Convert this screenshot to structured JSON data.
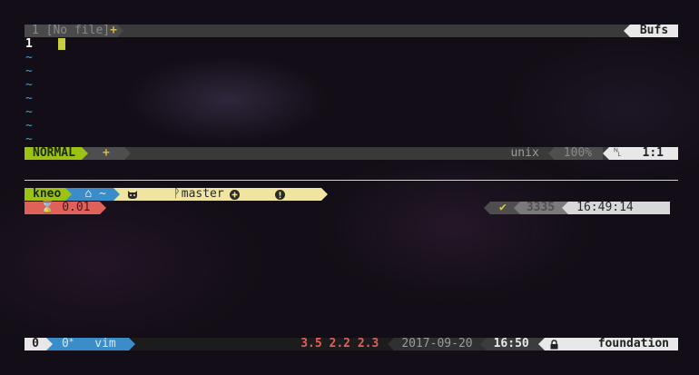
{
  "tabline": {
    "tab_number": "1",
    "tab_name": "[No file]",
    "modified_flag": "+",
    "right_label": "Bufs"
  },
  "buffer": {
    "line_number": "1",
    "tilde": "~"
  },
  "vim_statusline": {
    "mode": "NORMAL",
    "modified": "+",
    "fileformat": "unix",
    "percent": "100%",
    "position": "1:1"
  },
  "shell_prompt": {
    "user": "kneo",
    "cwd": "~",
    "branch": "master",
    "load": "0.01",
    "check": "✔",
    "history_number": "3335",
    "time": "16:49:14"
  },
  "tmux": {
    "session": "0",
    "window_index": "0",
    "window_flag": "*",
    "window_name": "vim",
    "load_1": "3.5",
    "load_5": "2.2",
    "load_15": "2.3",
    "date": "2017-09-20",
    "time": "16:50",
    "hostname": "foundation"
  },
  "colors": {
    "accent_green": "#9cc214",
    "accent_blue": "#3a8dc8",
    "accent_yellow": "#f0e5a0",
    "accent_red": "#e0605a",
    "cursor": "#c7cd3c"
  }
}
